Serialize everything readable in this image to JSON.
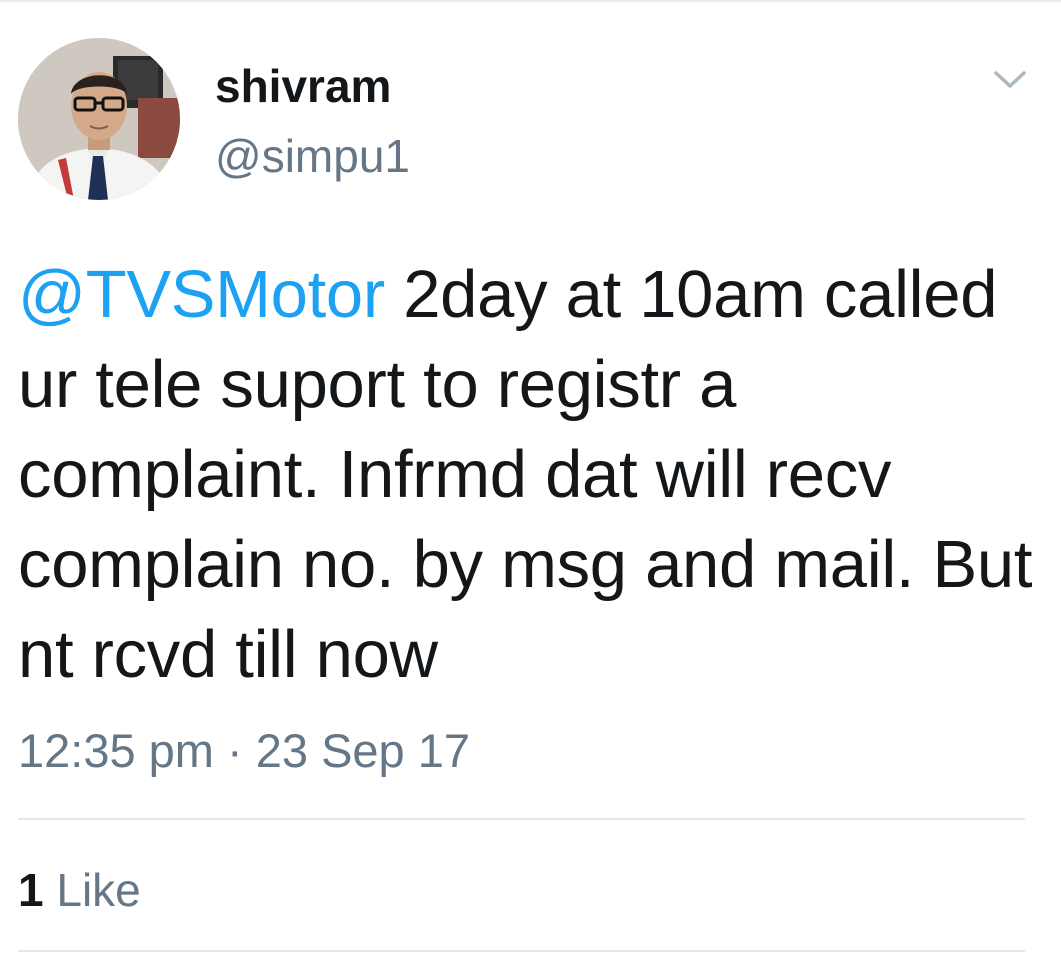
{
  "user": {
    "display_name": "shivram",
    "handle": "@simpu1",
    "avatar_icon": "profile-photo"
  },
  "tweet": {
    "mention": "@TVSMotor",
    "text": " 2day at 10am called ur tele suport to registr a complaint. Infrmd dat will recv complain no. by msg and mail. But nt rcvd till now",
    "timestamp": "12:35 pm · 23 Sep 17"
  },
  "stats": {
    "like_count": "1",
    "like_label": "Like"
  },
  "icons": {
    "menu": "chevron-down-icon"
  },
  "colors": {
    "mention": "#1da1f2",
    "secondary_text": "#657786",
    "primary_text": "#14171a",
    "divider": "#e1e8ed"
  }
}
